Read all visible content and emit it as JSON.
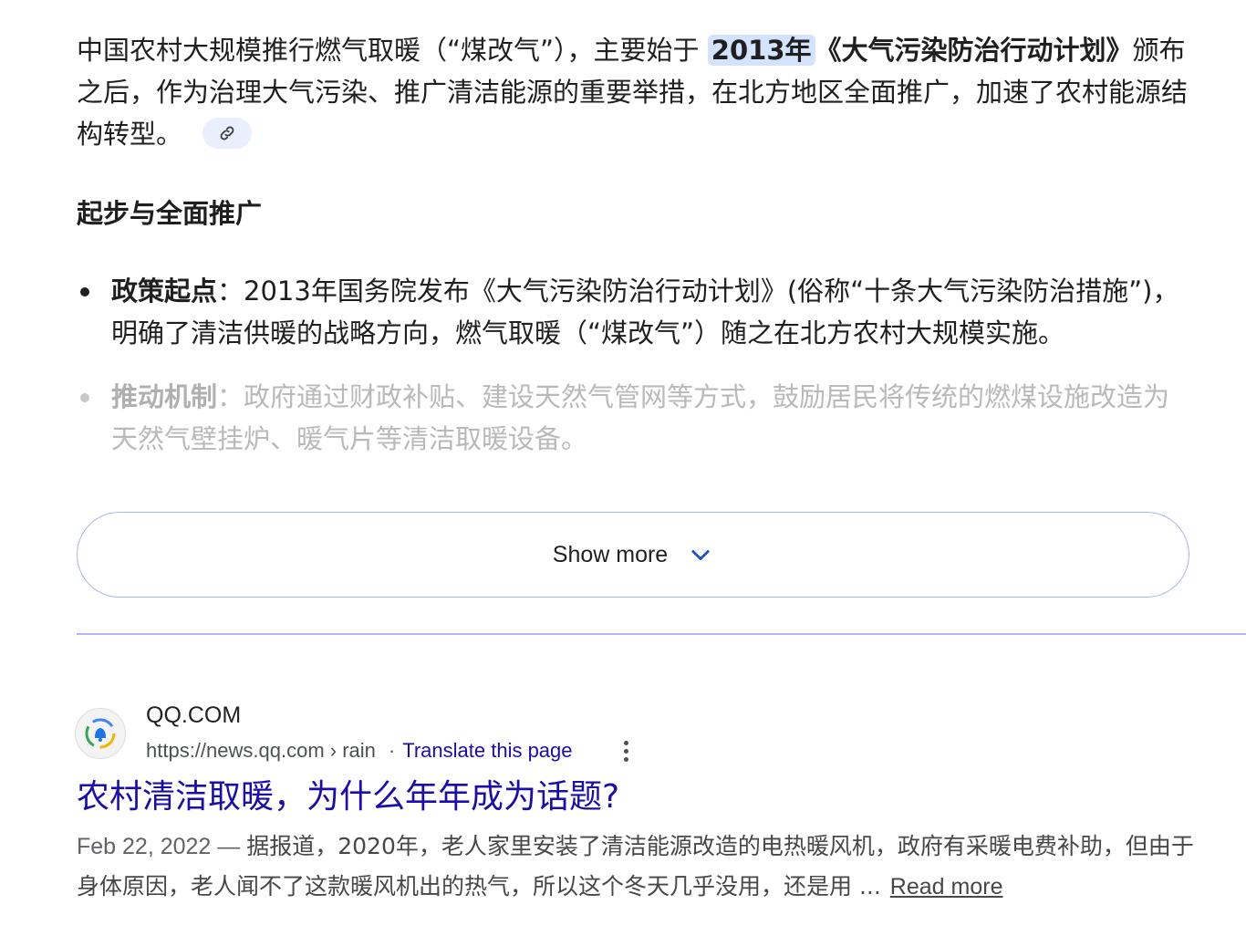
{
  "overview": {
    "intro_part1": "中国农村大规模推行燃气取暖（“煤改气”），主要始于 ",
    "intro_highlight": "2013年",
    "intro_bold": "《大气污染防治行动计划》",
    "intro_part2": "颁布之后，作为治理大气污染、推广清洁能源的重要举措，在北方地区全面推广，加速了农村能源结构转型。",
    "link_icon": "link-icon",
    "section_heading": "起步与全面推广",
    "bullets": [
      {
        "title": "政策起点",
        "text": "：2013年国务院发布《大气污染防治行动计划》(俗称“十条大气污染防治措施”)，明确了清洁供暖的战略方向，燃气取暖（“煤改气”）随之在北方农村大规模实施。"
      },
      {
        "title": "推动机制",
        "text": "：政府通过财政补贴、建设天然气管网等方式，鼓励居民将传统的燃煤设施改造为天然气壁挂炉、暖气片等清洁取暖设备。"
      }
    ],
    "show_more_label": "Show more",
    "show_more_icon": "chevron-down-icon"
  },
  "result": {
    "site_name": "QQ.COM",
    "url": "https://news.qq.com › rain",
    "separator": "·",
    "translate_label": "Translate this page",
    "title": "农村清洁取暖，为什么年年成为话题?",
    "date": "Feb 22, 2022 — ",
    "snippet": "据报道，2020年，老人家里安装了清洁能源改造的电热暖风机，政府有采暖电费补助，但由于身体原因，老人闻不了这款暖风机出的热气，所以这个冬天几乎没用，还是用 ...",
    "read_more_label": "Read more",
    "favicon_icon": "qq-bell-logo-icon",
    "menu_icon": "kebab-menu-icon"
  },
  "colors": {
    "link_blue": "#1a0dab",
    "highlight_bg": "#d3e3fd",
    "border_blue": "#a8b8f0"
  }
}
